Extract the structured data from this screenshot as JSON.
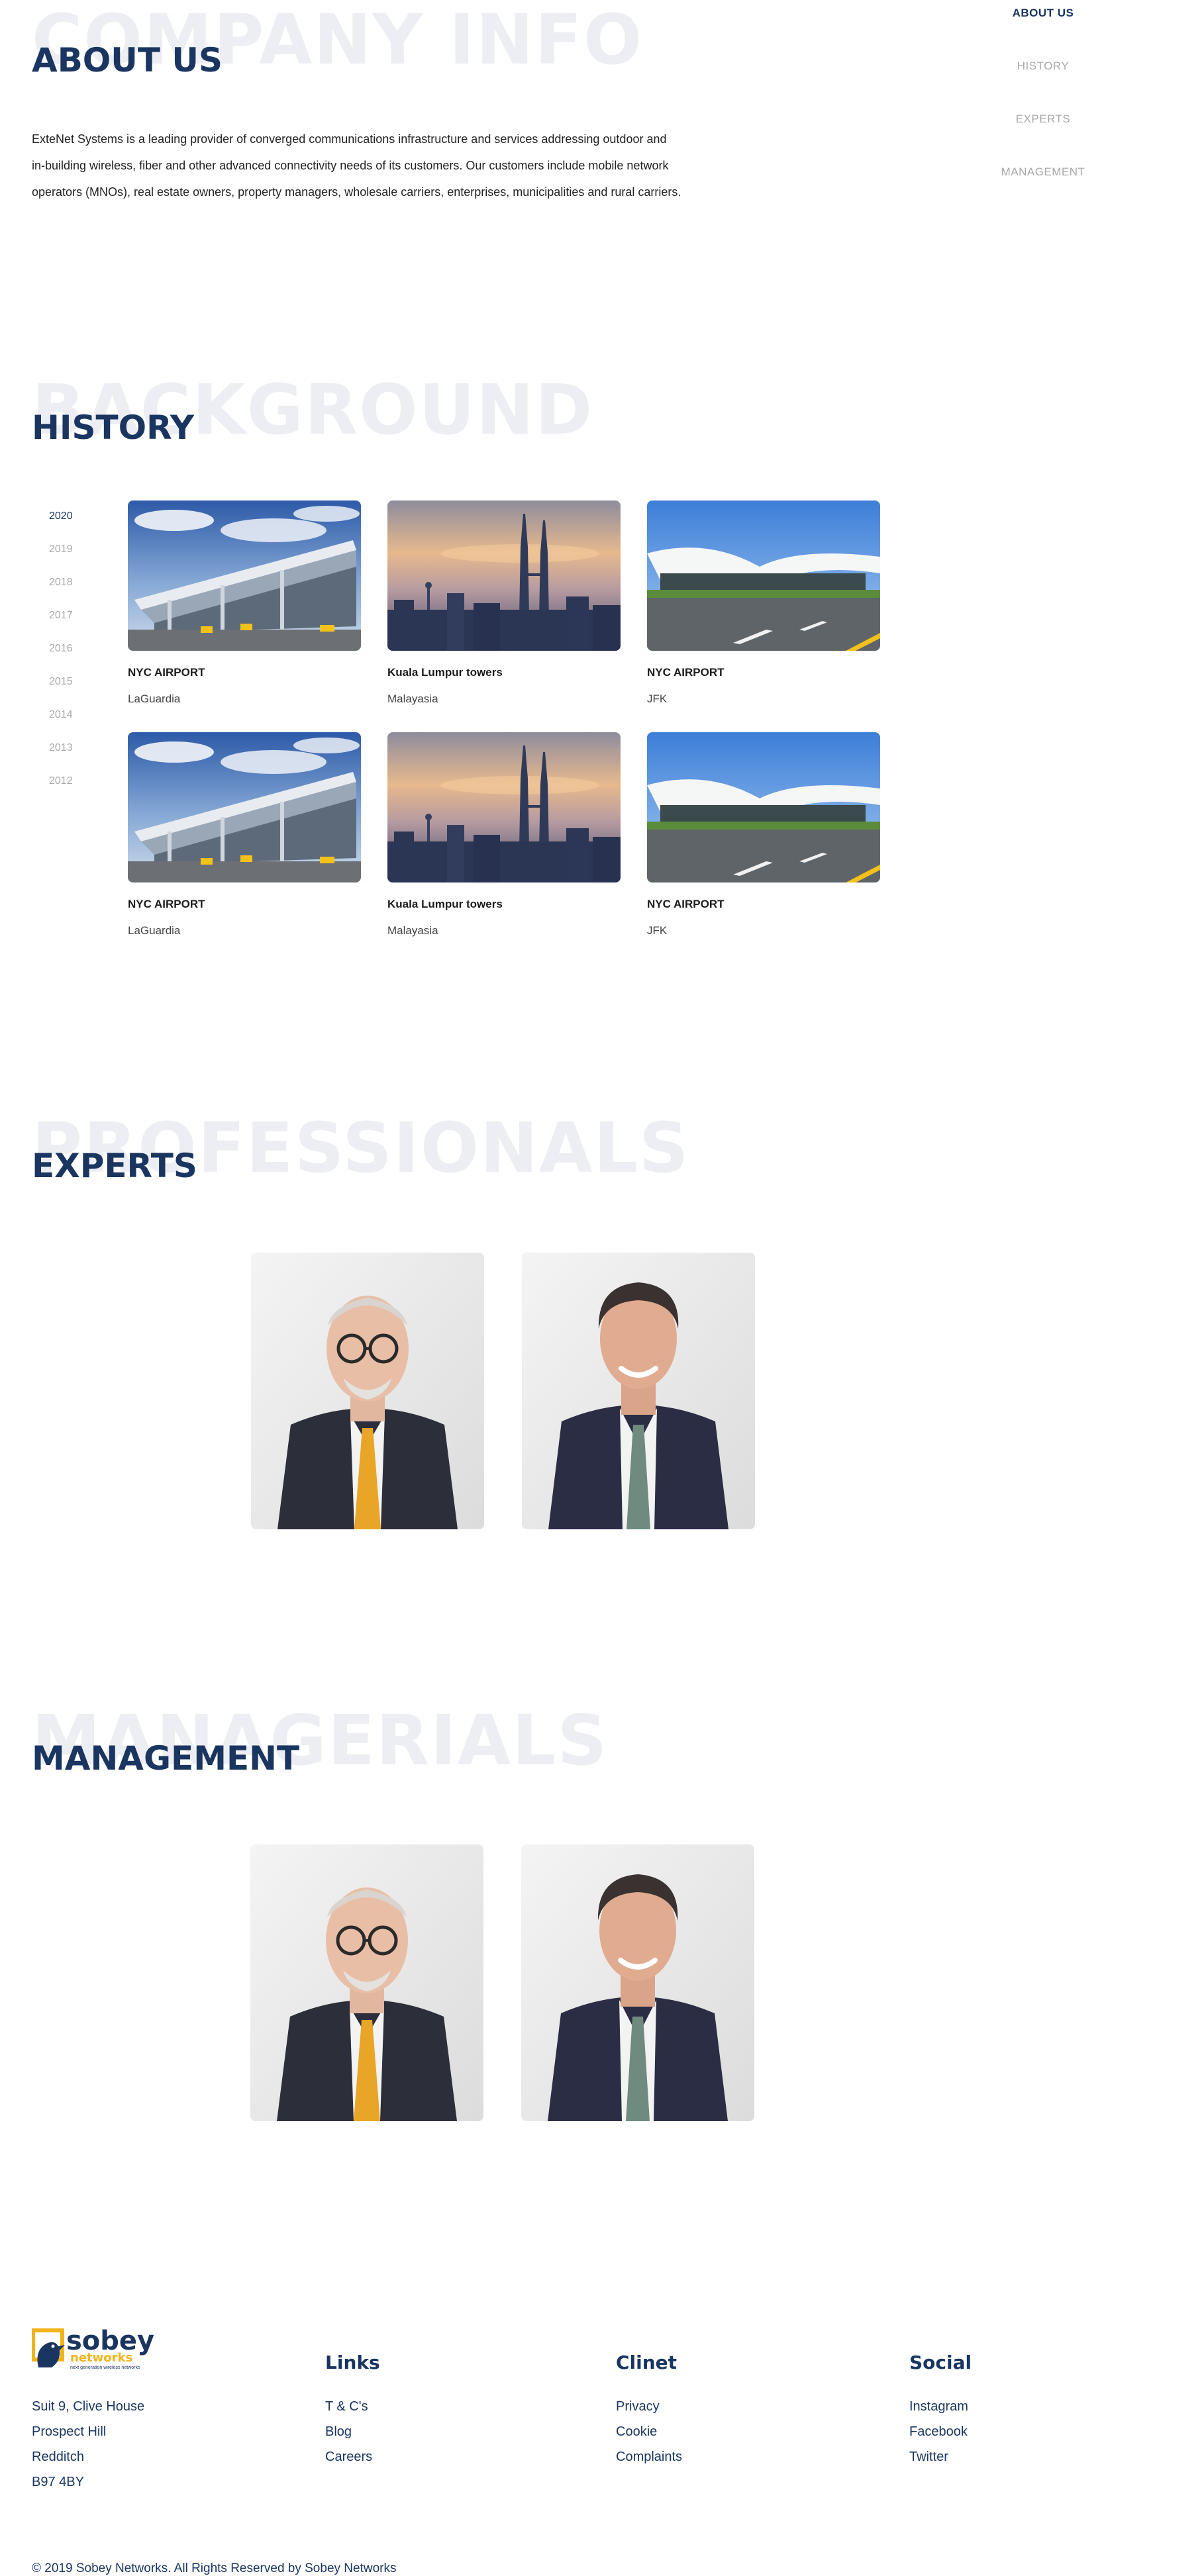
{
  "nav": {
    "items": [
      "ABOUT US",
      "HISTORY",
      "EXPERTS",
      "MANAGEMENT"
    ],
    "active_index": 0
  },
  "about": {
    "ghost": "COMPANY INFO",
    "heading": "ABOUT US",
    "lines": [
      "ExteNet Systems is a leading provider of converged communications infrastructure and services addressing outdoor and",
      "in-building wireless, fiber and other advanced connectivity needs of its customers. Our customers include mobile network",
      "operators (MNOs), real estate owners, property managers, wholesale carriers, enterprises, municipalities and rural carriers."
    ]
  },
  "history": {
    "ghost": "BACKGROUND",
    "heading": "HISTORY",
    "years": [
      "2020",
      "2019",
      "2018",
      "2017",
      "2016",
      "2015",
      "2014",
      "2013",
      "2012"
    ],
    "active_year_index": 0,
    "cards": [
      {
        "title": "NYC AIRPORT",
        "subtitle": "LaGuardia",
        "image": "airport-terminal"
      },
      {
        "title": "Kuala Lumpur towers",
        "subtitle": "Malayasia",
        "image": "petronas-towers"
      },
      {
        "title": "NYC AIRPORT",
        "subtitle": "JFK",
        "image": "twa-terminal"
      },
      {
        "title": "NYC AIRPORT",
        "subtitle": "LaGuardia",
        "image": "airport-terminal"
      },
      {
        "title": "Kuala Lumpur towers",
        "subtitle": "Malayasia",
        "image": "petronas-towers"
      },
      {
        "title": "NYC AIRPORT",
        "subtitle": "JFK",
        "image": "twa-terminal"
      }
    ]
  },
  "experts": {
    "ghost": "PROFESSIONALS",
    "heading": "EXPERTS",
    "people": [
      "older-man-glasses-yellow-tie",
      "younger-man-green-tie"
    ]
  },
  "management": {
    "ghost": "MANAGERIALS",
    "heading": "MANAGEMENT",
    "people": [
      "older-man-glasses-yellow-tie",
      "younger-man-green-tie"
    ]
  },
  "footer": {
    "logo": {
      "name": "sobey",
      "sub": "networks",
      "tagline": "next generation wireless networks"
    },
    "address": [
      "Suit 9, Clive House",
      "Prospect Hill",
      "Redditch",
      "B97 4BY"
    ],
    "links": {
      "title": "Links",
      "items": [
        "T & C's",
        "Blog",
        "Careers"
      ]
    },
    "client": {
      "title": "Clinet",
      "items": [
        "Privacy",
        "Cookie",
        "Complaints"
      ]
    },
    "social": {
      "title": "Social",
      "items": [
        "Instagram",
        "Facebook",
        "Twitter"
      ]
    },
    "copyright": "© 2019 Sobey Networks. All Rights Reserved by Sobey Networks"
  },
  "colors": {
    "brand_navy": "#1a3560",
    "logo_gold": "#f0b419",
    "ghost": "#edeef3"
  }
}
